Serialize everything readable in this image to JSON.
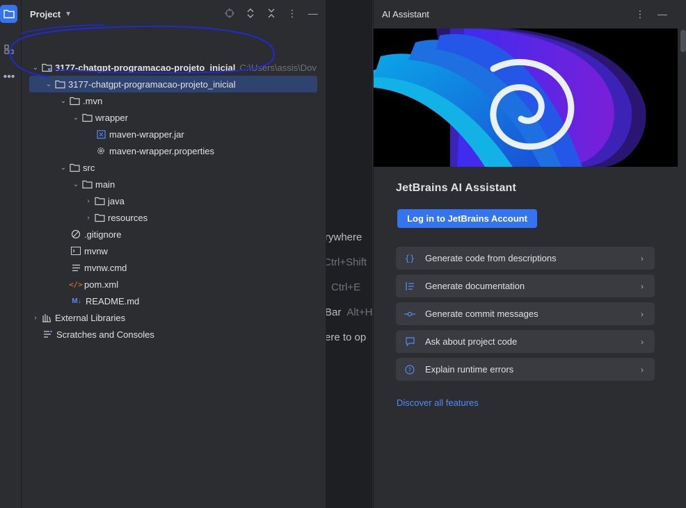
{
  "project_panel": {
    "title": "Project",
    "tree": [
      {
        "label": "3177-chatgpt-programacao-projeto_inicial",
        "path": "C:\\Users\\assis\\Dov",
        "bold": true
      },
      {
        "label": "3177-chatgpt-programacao-projeto_inicial",
        "selected": true
      },
      {
        "label": ".mvn"
      },
      {
        "label": "wrapper"
      },
      {
        "label": "maven-wrapper.jar"
      },
      {
        "label": "maven-wrapper.properties"
      },
      {
        "label": "src"
      },
      {
        "label": "main"
      },
      {
        "label": "java"
      },
      {
        "label": "resources"
      },
      {
        "label": ".gitignore"
      },
      {
        "label": "mvnw"
      },
      {
        "label": "mvnw.cmd"
      },
      {
        "label": "pom.xml"
      },
      {
        "label": "README.md"
      },
      {
        "label": "External Libraries"
      },
      {
        "label": "Scratches and Consoles"
      }
    ]
  },
  "editor_hints": [
    {
      "text": "rywhere",
      "key": ""
    },
    {
      "text": "",
      "key": "Ctrl+Shift"
    },
    {
      "text": "",
      "key": "Ctrl+E"
    },
    {
      "text": "Bar",
      "key": "Alt+H"
    },
    {
      "text": "ere to op",
      "key": ""
    }
  ],
  "ai_panel": {
    "title": "AI Assistant",
    "heading": "JetBrains AI Assistant",
    "login_label": "Log in to JetBrains Account",
    "features": [
      {
        "label": "Generate code from descriptions",
        "icon": "braces-icon"
      },
      {
        "label": "Generate documentation",
        "icon": "doc-lines-icon"
      },
      {
        "label": "Generate commit messages",
        "icon": "commit-icon"
      },
      {
        "label": "Ask about project code",
        "icon": "chat-bubble-icon"
      },
      {
        "label": "Explain runtime errors",
        "icon": "question-icon"
      }
    ],
    "discover_label": "Discover all features"
  },
  "colors": {
    "accent": "#3574f0",
    "link": "#548af7",
    "panel_bg": "#2b2d30",
    "selection": "#2e436e",
    "annotation": "#1f2ad6"
  }
}
